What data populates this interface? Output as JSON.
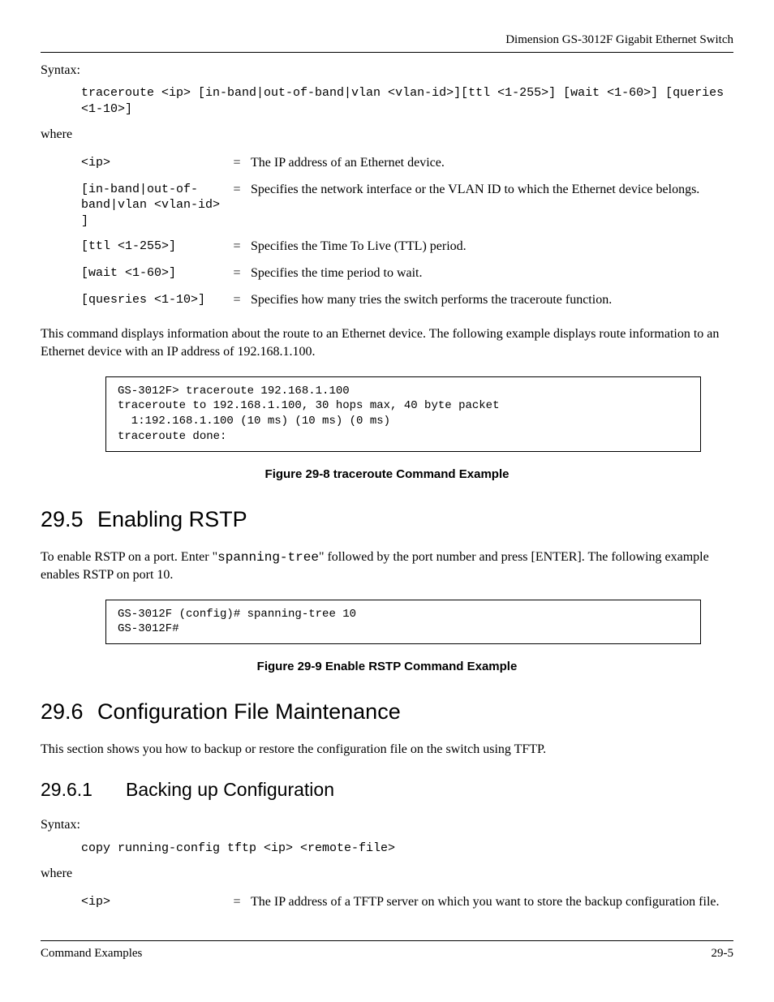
{
  "header": "Dimension GS-3012F Gigabit Ethernet Switch",
  "syntax_label": "Syntax:",
  "where_label": "where",
  "traceroute_syntax": "traceroute <ip> [in-band|out-of-band|vlan <vlan-id>][ttl <1-255>] [wait <1-60>] [queries <1-10>]",
  "params": [
    {
      "name": "<ip>",
      "desc": "The IP address of an Ethernet device."
    },
    {
      "name": "[in-band|out-of-band|vlan <vlan-id> ]",
      "desc": "Specifies the network interface or the VLAN ID to which the Ethernet device belongs."
    },
    {
      "name": "[ttl <1-255>]",
      "desc": "Specifies the Time To Live (TTL) period."
    },
    {
      "name": "[wait <1-60>]",
      "desc": "Specifies the time period to wait."
    },
    {
      "name": "[quesries <1-10>]",
      "desc": "Specifies how many tries the switch performs the traceroute function."
    }
  ],
  "traceroute_para": "This command displays information about the route to an Ethernet device. The following example displays route information to an Ethernet device with an IP address of 192.168.1.100.",
  "traceroute_example": "GS-3012F> traceroute 192.168.1.100\ntraceroute to 192.168.1.100, 30 hops max, 40 byte packet\n  1:192.168.1.100 (10 ms) (10 ms) (0 ms)\ntraceroute done:",
  "fig_29_8": "Figure 29-8 traceroute Command Example",
  "sec_29_5_num": "29.5",
  "sec_29_5_title": "Enabling RSTP",
  "rstp_para_pre": "To enable RSTP on a port. Enter \"",
  "rstp_cmd": "spanning-tree",
  "rstp_para_post": "\" followed by the port number and press [ENTER]. The following example enables RSTP on port 10.",
  "rstp_example": "GS-3012F (config)# spanning-tree 10\nGS-3012F#",
  "fig_29_9": "Figure 29-9 Enable RSTP Command Example",
  "sec_29_6_num": "29.6",
  "sec_29_6_title": "Configuration File Maintenance",
  "cfg_para": "This section shows you how to backup or restore the configuration file on the switch using TFTP.",
  "sec_29_6_1_num": "29.6.1",
  "sec_29_6_1_title": "Backing up Configuration",
  "backup_syntax": "copy running-config tftp <ip> <remote-file>",
  "backup_params": [
    {
      "name": "<ip>",
      "desc": "The IP address of a TFTP server on which you want to store the backup configuration file."
    }
  ],
  "footer_left": "Command Examples",
  "footer_right": "29-5",
  "eq": "="
}
